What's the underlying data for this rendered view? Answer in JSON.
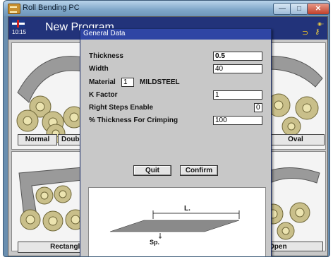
{
  "window": {
    "title": "Roll Bending PC",
    "min_glyph": "—",
    "max_glyph": "□",
    "close_glyph": "✕"
  },
  "header": {
    "time": "10:15",
    "program_title": "New Program"
  },
  "tiles": {
    "normal_label": "Normal",
    "double_label": "Doubl",
    "oval_label": "Oval",
    "rectangle_label": "Rectangle",
    "open_label": "Open"
  },
  "dialog": {
    "title": "General Data",
    "fields": {
      "thickness_label": "Thickness",
      "thickness_value": "0.5",
      "width_label": "Width",
      "width_value": "40",
      "material_label": "Material",
      "material_code": "1",
      "material_name": "MILDSTEEL",
      "kfactor_label": "K Factor",
      "kfactor_value": "1",
      "right_steps_label": "Right Steps Enable",
      "right_steps_value": "0",
      "crimping_label": "% Thickness For Crimping",
      "crimping_value": "100"
    },
    "quit_label": "Quit",
    "confirm_label": "Confirm",
    "diagram": {
      "length_label": "L.",
      "thickness_label": "Sp."
    }
  },
  "colors": {
    "header_bg": "#22337a",
    "dialog_title_bg": "#2f45a4",
    "roll_color": "#c9bf8a",
    "sheet_color": "#8a8a8a"
  },
  "icons": [
    "app-icon",
    "uk-flag-icon",
    "lock-icon",
    "keys-icon",
    "signal-icon"
  ]
}
